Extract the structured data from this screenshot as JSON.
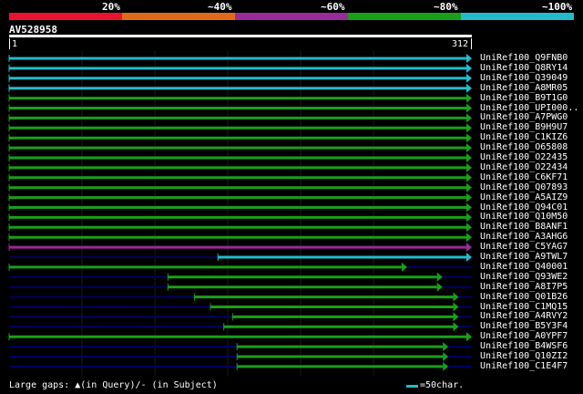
{
  "legend": {
    "labels": [
      "20%",
      "~40%",
      "~60%",
      "~80%",
      "~100%"
    ],
    "colors": [
      "#e8132e",
      "#e06a18",
      "#982a9a",
      "#18a018",
      "#22bbcc"
    ]
  },
  "query": {
    "id": "AV528958",
    "start": "1",
    "end": "312"
  },
  "hits": [
    {
      "label": "UniRef100_Q9FNB0",
      "color": "cyan",
      "start": 1,
      "end": 312
    },
    {
      "label": "UniRef100_Q8RY14",
      "color": "cyan",
      "start": 1,
      "end": 312
    },
    {
      "label": "UniRef100_Q39049",
      "color": "cyan",
      "start": 1,
      "end": 312
    },
    {
      "label": "UniRef100_A8MR05",
      "color": "cyan",
      "start": 1,
      "end": 312
    },
    {
      "label": "UniRef100_B9T1G0",
      "color": "green",
      "start": 1,
      "end": 312
    },
    {
      "label": "UniRef100_UPI000..",
      "color": "green",
      "start": 1,
      "end": 312
    },
    {
      "label": "UniRef100_A7PWG0",
      "color": "green",
      "start": 1,
      "end": 312
    },
    {
      "label": "UniRef100_B9H9U7",
      "color": "green",
      "start": 1,
      "end": 312
    },
    {
      "label": "UniRef100_C1KIZ6",
      "color": "green",
      "start": 1,
      "end": 312
    },
    {
      "label": "UniRef100_O65808",
      "color": "green",
      "start": 1,
      "end": 312
    },
    {
      "label": "UniRef100_O22435",
      "color": "green",
      "start": 1,
      "end": 312
    },
    {
      "label": "UniRef100_O22434",
      "color": "green",
      "start": 1,
      "end": 312
    },
    {
      "label": "UniRef100_C6KF71",
      "color": "green",
      "start": 1,
      "end": 312
    },
    {
      "label": "UniRef100_Q07893",
      "color": "green",
      "start": 1,
      "end": 312
    },
    {
      "label": "UniRef100_A5AIZ9",
      "color": "green",
      "start": 1,
      "end": 312
    },
    {
      "label": "UniRef100_Q94C01",
      "color": "green",
      "start": 1,
      "end": 312
    },
    {
      "label": "UniRef100_Q10M50",
      "color": "green",
      "start": 1,
      "end": 312
    },
    {
      "label": "UniRef100_B8ANF1",
      "color": "green",
      "start": 1,
      "end": 312
    },
    {
      "label": "UniRef100_A3AHG6",
      "color": "green",
      "start": 1,
      "end": 312
    },
    {
      "label": "UniRef100_C5YAG7",
      "color": "purple",
      "start": 1,
      "end": 312
    },
    {
      "label": "UniRef100_A9TWL7",
      "color": "cyan",
      "start": 143,
      "end": 312
    },
    {
      "label": "UniRef100_Q40001",
      "color": "green",
      "start": 1,
      "end": 268
    },
    {
      "label": "UniRef100_Q93WE2",
      "color": "green",
      "start": 109,
      "end": 292
    },
    {
      "label": "UniRef100_A8I7P5",
      "color": "green",
      "start": 109,
      "end": 292
    },
    {
      "label": "UniRef100_Q01B26",
      "color": "green",
      "start": 127,
      "end": 303
    },
    {
      "label": "UniRef100_C1MQ15",
      "color": "green",
      "start": 138,
      "end": 303
    },
    {
      "label": "UniRef100_A4RVY2",
      "color": "green",
      "start": 153,
      "end": 303
    },
    {
      "label": "UniRef100_B5Y3F4",
      "color": "green",
      "start": 147,
      "end": 303
    },
    {
      "label": "UniRef100_A0YPF7",
      "color": "green",
      "start": 1,
      "end": 312
    },
    {
      "label": "UniRef100_B4WSF6",
      "color": "green",
      "start": 156,
      "end": 296
    },
    {
      "label": "UniRef100_Q10ZI2",
      "color": "green",
      "start": 156,
      "end": 296
    },
    {
      "label": "UniRef100_C1E4F7",
      "color": "green",
      "start": 156,
      "end": 296
    }
  ],
  "footer": {
    "gaps_label": "Large gaps: ▲(in Query)/- (in Subject)",
    "scale_label": "=50char."
  }
}
